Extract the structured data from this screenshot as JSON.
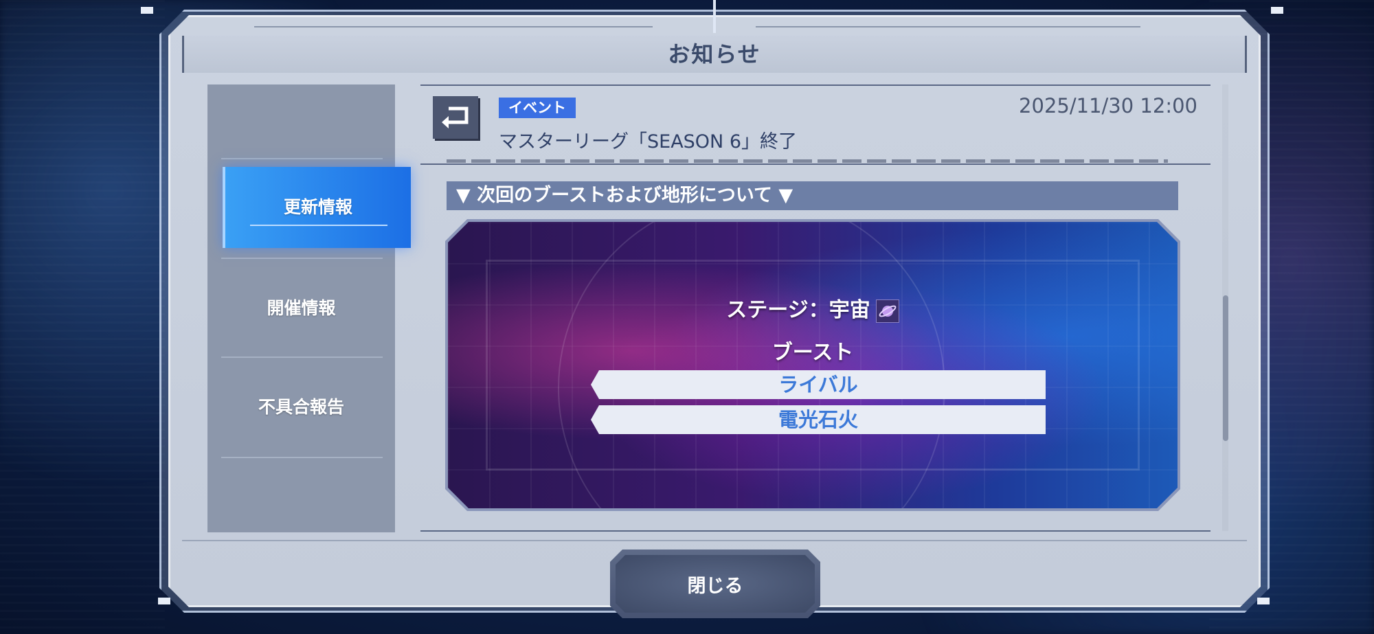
{
  "dialog": {
    "title": "お知らせ"
  },
  "sidebar": {
    "items": [
      {
        "label": "更新情報",
        "active": true
      },
      {
        "label": "開催情報",
        "active": false
      },
      {
        "label": "不具合報告",
        "active": false
      }
    ]
  },
  "news": {
    "category": "イベント",
    "datetime": "2025/11/30 12:00",
    "title": "マスターリーグ「SEASON 6」終了",
    "section_header": "▼ 次回のブーストおよび地形について ▼",
    "banner": {
      "stage_label": "ステージ：宇宙",
      "stage_icon": "planet-icon",
      "boost_heading": "ブースト",
      "boosts": [
        "ライバル",
        "電光石火"
      ]
    }
  },
  "footer": {
    "close_label": "閉じる"
  },
  "colors": {
    "accent_blue": "#3a6fe3",
    "active_tab": "#1c6fe5",
    "boost_text": "#3c79d8"
  }
}
